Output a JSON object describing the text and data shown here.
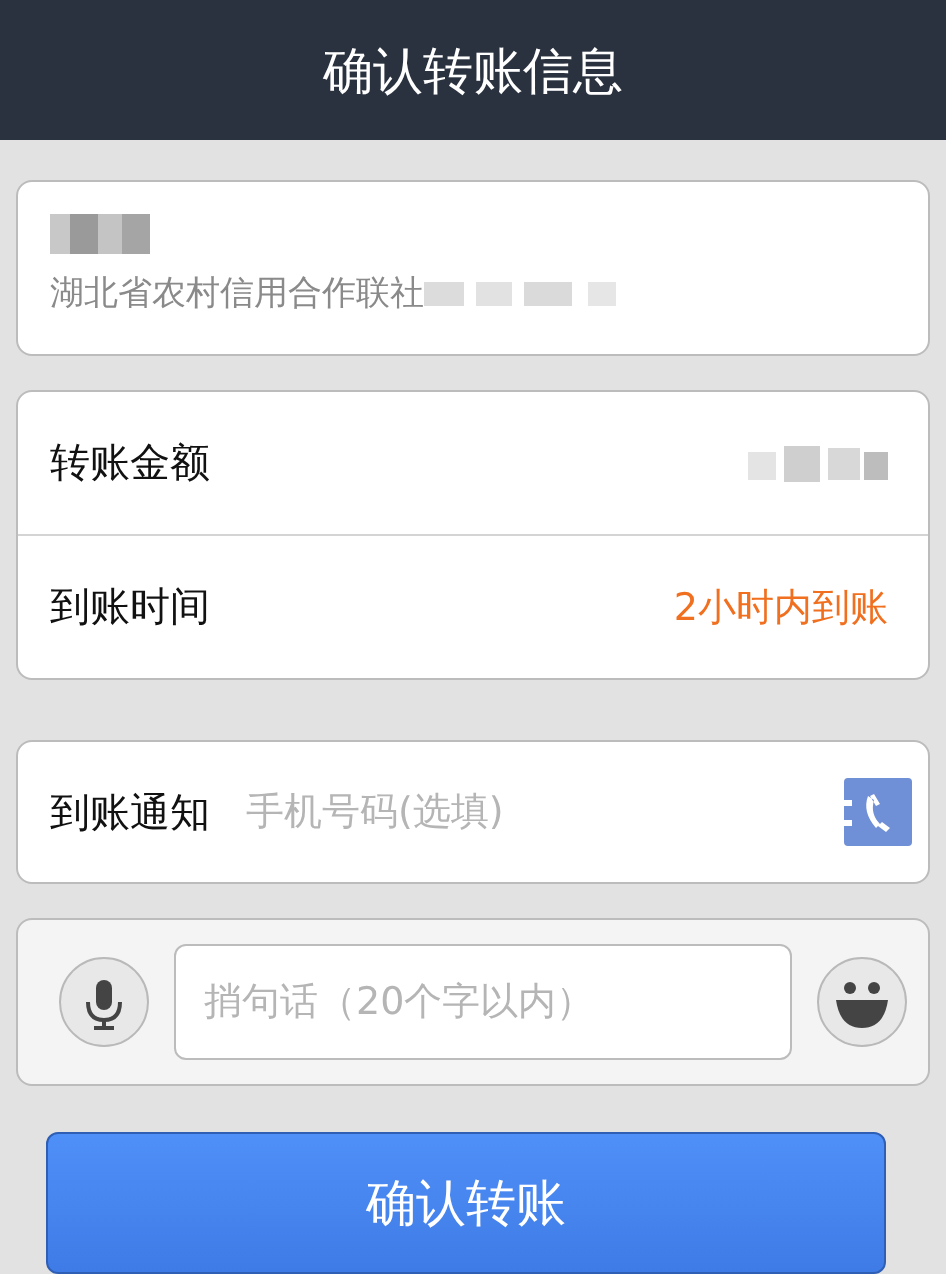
{
  "header": {
    "title": "确认转账信息"
  },
  "payee": {
    "bank": "湖北省农村信用合作联社"
  },
  "details": [
    {
      "label": "转账金额",
      "kind": "redacted"
    },
    {
      "label": "到账时间",
      "kind": "text",
      "value": "2小时内到账"
    }
  ],
  "notify": {
    "label": "到账通知",
    "placeholder": "手机号码(选填)"
  },
  "message": {
    "placeholder": "捎句话（20个字以内）"
  },
  "confirm_button": "确认转账"
}
